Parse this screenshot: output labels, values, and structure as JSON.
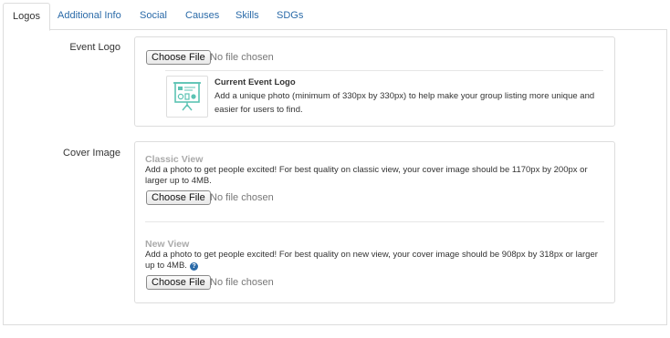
{
  "tabs": [
    {
      "label": "Logos",
      "active": true
    },
    {
      "label": "Additional Info",
      "active": false
    },
    {
      "label": "Social",
      "active": false
    },
    {
      "label": "Causes",
      "active": false
    },
    {
      "label": "Skills",
      "active": false
    },
    {
      "label": "SDGs",
      "active": false
    }
  ],
  "event_logo": {
    "label": "Event Logo",
    "choose_file": "Choose File",
    "status": "No file chosen",
    "current_title": "Current Event Logo",
    "current_desc": "Add a unique photo (minimum of 330px by 330px) to help make your group listing more unique and easier for users to find.",
    "thumb_icon": "presentation-board-icon"
  },
  "cover_image": {
    "label": "Cover Image",
    "classic": {
      "title": "Classic View",
      "desc": "Add a photo to get people excited! For best quality on classic view, your cover image should be 1170px by 200px or larger up to 4MB.",
      "choose_file": "Choose File",
      "status": "No file chosen"
    },
    "new": {
      "title": "New View",
      "desc": "Add a photo to get people excited! For best quality on new view, your cover image should be 908px by 318px or larger up to 4MB.",
      "help_icon": "?",
      "choose_file": "Choose File",
      "status": "No file chosen"
    }
  },
  "colors": {
    "link": "#2a6aa8",
    "border": "#dddddd",
    "thumb_accent": "#5cc3b3"
  }
}
